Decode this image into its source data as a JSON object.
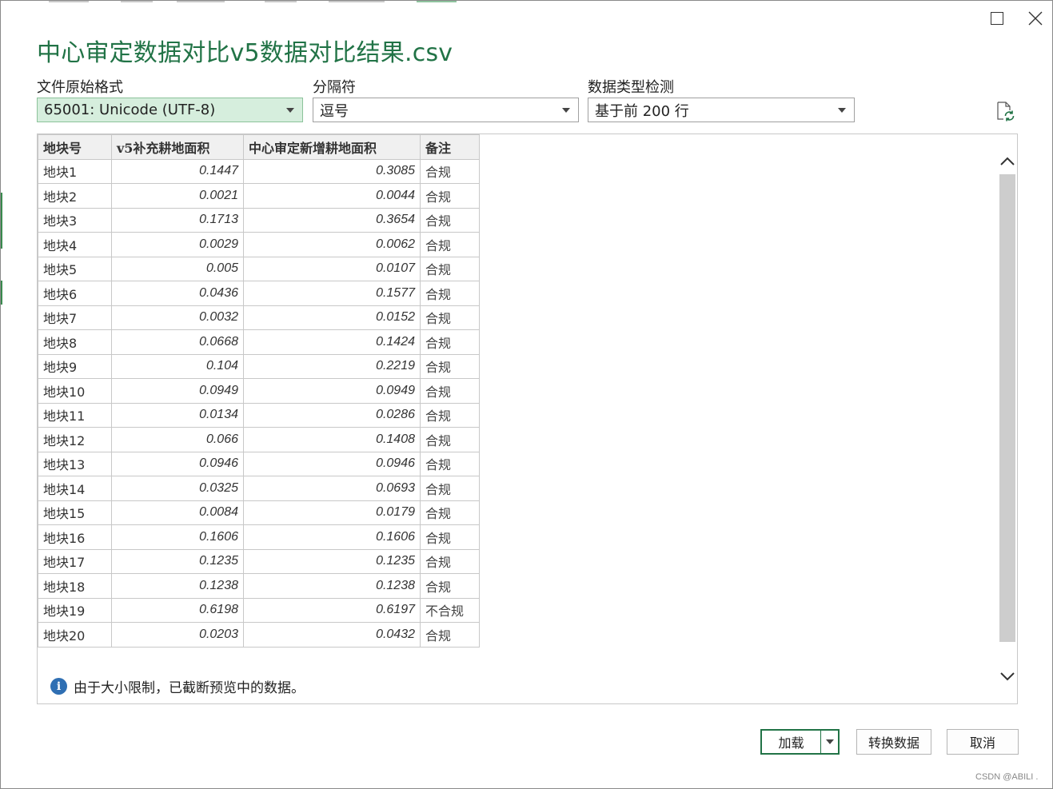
{
  "dialog": {
    "title": "中心审定数据对比v5数据对比结果.csv"
  },
  "options": {
    "encoding": {
      "label": "文件原始格式",
      "value": "65001: Unicode (UTF-8)"
    },
    "delimiter": {
      "label": "分隔符",
      "value": "逗号"
    },
    "detection": {
      "label": "数据类型检测",
      "value": "基于前 200 行"
    }
  },
  "table": {
    "headers": [
      "地块号",
      "v5补充耕地面积",
      "中心审定新增耕地面积",
      "备注"
    ],
    "rows": [
      [
        "地块1",
        "0.1447",
        "0.3085",
        "合规"
      ],
      [
        "地块2",
        "0.0021",
        "0.0044",
        "合规"
      ],
      [
        "地块3",
        "0.1713",
        "0.3654",
        "合规"
      ],
      [
        "地块4",
        "0.0029",
        "0.0062",
        "合规"
      ],
      [
        "地块5",
        "0.005",
        "0.0107",
        "合规"
      ],
      [
        "地块6",
        "0.0436",
        "0.1577",
        "合规"
      ],
      [
        "地块7",
        "0.0032",
        "0.0152",
        "合规"
      ],
      [
        "地块8",
        "0.0668",
        "0.1424",
        "合规"
      ],
      [
        "地块9",
        "0.104",
        "0.2219",
        "合规"
      ],
      [
        "地块10",
        "0.0949",
        "0.0949",
        "合规"
      ],
      [
        "地块11",
        "0.0134",
        "0.0286",
        "合规"
      ],
      [
        "地块12",
        "0.066",
        "0.1408",
        "合规"
      ],
      [
        "地块13",
        "0.0946",
        "0.0946",
        "合规"
      ],
      [
        "地块14",
        "0.0325",
        "0.0693",
        "合规"
      ],
      [
        "地块15",
        "0.0084",
        "0.0179",
        "合规"
      ],
      [
        "地块16",
        "0.1606",
        "0.1606",
        "合规"
      ],
      [
        "地块17",
        "0.1235",
        "0.1235",
        "合规"
      ],
      [
        "地块18",
        "0.1238",
        "0.1238",
        "合规"
      ],
      [
        "地块19",
        "0.6198",
        "0.6197",
        "不合规"
      ],
      [
        "地块20",
        "0.0203",
        "0.0432",
        "合规"
      ]
    ]
  },
  "notice": {
    "text": "由于大小限制，已截断预览中的数据。",
    "icon": "info-icon"
  },
  "buttons": {
    "load": "加载",
    "transform": "转换数据",
    "cancel": "取消"
  },
  "watermark": "CSDN @ABILI .",
  "colors": {
    "accent": "#217346",
    "active_field_bg": "#d6eedd",
    "info": "#2f6fb3"
  }
}
